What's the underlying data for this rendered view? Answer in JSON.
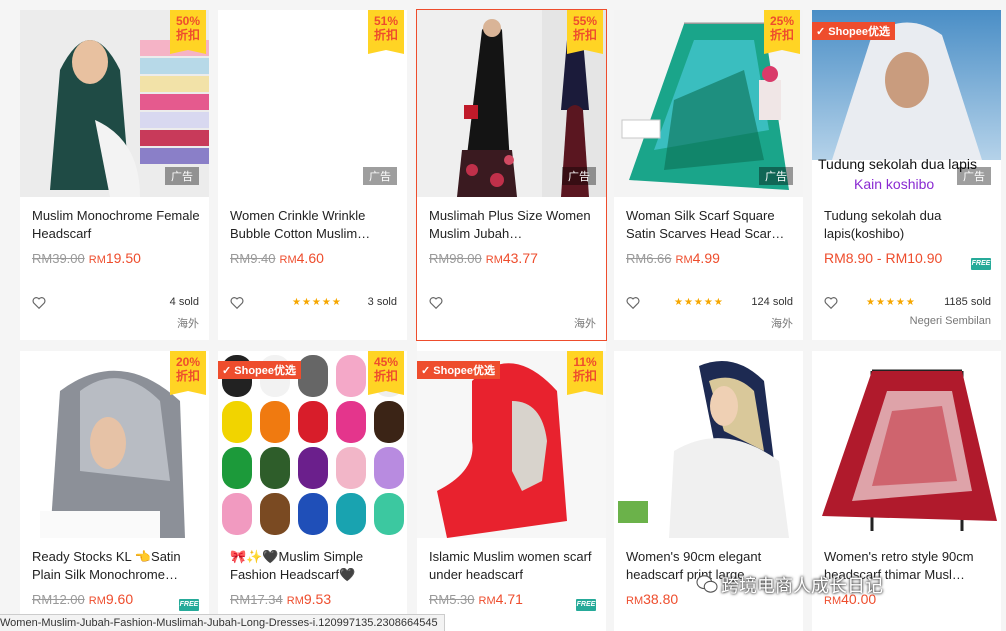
{
  "row1": [
    {
      "discount_pct": "50%",
      "discount_label": "折扣",
      "ad": "广告",
      "name": "Muslim Monochrome Female Headscarf",
      "old_price": "RM39.00",
      "new_cur": "RM",
      "new_val": "19.50",
      "sold": "4 sold",
      "location": "海外"
    },
    {
      "discount_pct": "51%",
      "discount_label": "折扣",
      "ad": "广告",
      "name": "Women Crinkle Wrinkle Bubble Cotton Muslim…",
      "old_price": "RM9.40",
      "new_cur": "RM",
      "new_val": "4.60",
      "stars": "★★★★★",
      "sold": "3 sold",
      "location": ""
    },
    {
      "discount_pct": "55%",
      "discount_label": "折扣",
      "ad": "广告",
      "name": "Muslimah Plus Size Women Muslim Jubah…",
      "old_price": "RM98.00",
      "new_cur": "RM",
      "new_val": "43.77",
      "sold": "",
      "location": "海外"
    },
    {
      "discount_pct": "25%",
      "discount_label": "折扣",
      "ad": "广告",
      "name": "Woman Silk Scarf Square Satin Scarves Head Scar…",
      "old_price": "RM6.66",
      "new_cur": "RM",
      "new_val": "4.99",
      "stars": "★★★★★",
      "sold": "124 sold",
      "location": "海外"
    },
    {
      "preferred": "Shopee优选",
      "ad": "广告",
      "img_text1": "Tudung sekolah dua lapis",
      "img_text2": "Kain koshibo",
      "name": "Tudung sekolah dua lapis(koshibo)",
      "range": "RM8.90 - RM10.90",
      "free": "FREE",
      "stars": "★★★★★",
      "sold": "1185 sold",
      "location": "Negeri Sembilan"
    }
  ],
  "row2": [
    {
      "discount_pct": "20%",
      "discount_label": "折扣",
      "name": "Ready Stocks KL 👈Satin Plain Silk Monochrome…",
      "old_price": "RM12.00",
      "new_cur": "RM",
      "new_val": "9.60",
      "free": "FREE"
    },
    {
      "preferred": "Shopee优选",
      "discount_pct": "45%",
      "discount_label": "折扣",
      "name": "🎀✨🖤Muslim Simple Fashion Headscarf🖤",
      "old_price": "RM17.34",
      "new_cur": "RM",
      "new_val": "9.53"
    },
    {
      "preferred": "Shopee优选",
      "discount_pct": "11%",
      "discount_label": "折扣",
      "name": "Islamic Muslim women scarf under headscarf",
      "old_price": "RM5.30",
      "new_cur": "RM",
      "new_val": "4.71",
      "free": "FREE"
    },
    {
      "name": "Women's 90cm elegant headscarf print large…",
      "new_cur": "RM",
      "new_val": "38.80"
    },
    {
      "name": "Women's retro style 90cm headscarf thimar Musl…",
      "new_cur": "RM",
      "new_val": "40.00"
    }
  ],
  "status_url": "Women-Muslim-Jubah-Fashion-Muslimah-Jubah-Long-Dresses-i.120997135.2308664545",
  "watermark": "跨境电商人成长日记"
}
